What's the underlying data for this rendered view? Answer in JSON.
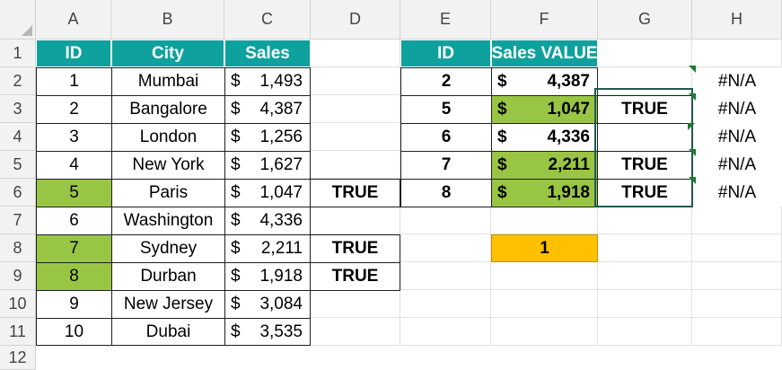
{
  "columns": [
    "A",
    "B",
    "C",
    "D",
    "E",
    "F",
    "G",
    "H"
  ],
  "rows": [
    "1",
    "2",
    "3",
    "4",
    "5",
    "6",
    "7",
    "8",
    "9",
    "10",
    "11",
    "12"
  ],
  "table1": {
    "headers": {
      "id": "ID",
      "city": "City",
      "sales": "Sales"
    },
    "records": [
      {
        "id": "1",
        "city": "Mumbai",
        "cur": "$",
        "sales": "1,493",
        "d": ""
      },
      {
        "id": "2",
        "city": "Bangalore",
        "cur": "$",
        "sales": "4,387",
        "d": ""
      },
      {
        "id": "3",
        "city": "London",
        "cur": "$",
        "sales": "1,256",
        "d": ""
      },
      {
        "id": "4",
        "city": "New York",
        "cur": "$",
        "sales": "1,627",
        "d": ""
      },
      {
        "id": "5",
        "city": "Paris",
        "cur": "$",
        "sales": "1,047",
        "d": "TRUE"
      },
      {
        "id": "6",
        "city": "Washington",
        "cur": "$",
        "sales": "4,336",
        "d": ""
      },
      {
        "id": "7",
        "city": "Sydney",
        "cur": "$",
        "sales": "2,211",
        "d": "TRUE"
      },
      {
        "id": "8",
        "city": "Durban",
        "cur": "$",
        "sales": "1,918",
        "d": "TRUE"
      },
      {
        "id": "9",
        "city": "New Jersey",
        "cur": "$",
        "sales": "3,084",
        "d": ""
      },
      {
        "id": "10",
        "city": "Dubai",
        "cur": "$",
        "sales": "3,535",
        "d": ""
      }
    ],
    "highlighted_ids": [
      "5",
      "7",
      "8"
    ]
  },
  "table2": {
    "headers": {
      "id": "ID",
      "sales_value": "Sales VALUE"
    },
    "records": [
      {
        "id": "2",
        "cur": "$",
        "value": "4,387",
        "g": "",
        "h": "#N/A",
        "highlight": false
      },
      {
        "id": "5",
        "cur": "$",
        "value": "1,047",
        "g": "TRUE",
        "h": "#N/A",
        "highlight": true
      },
      {
        "id": "6",
        "cur": "$",
        "value": "4,336",
        "g": "",
        "h": "#N/A",
        "highlight": false
      },
      {
        "id": "7",
        "cur": "$",
        "value": "2,211",
        "g": "TRUE",
        "h": "#N/A",
        "highlight": true
      },
      {
        "id": "8",
        "cur": "$",
        "value": "1,918",
        "g": "TRUE",
        "h": "#N/A",
        "highlight": true
      }
    ]
  },
  "count_cell": "1",
  "colors": {
    "header_teal": "#0fa19d",
    "highlight_green": "#99c544",
    "count_gold": "#ffc000"
  }
}
